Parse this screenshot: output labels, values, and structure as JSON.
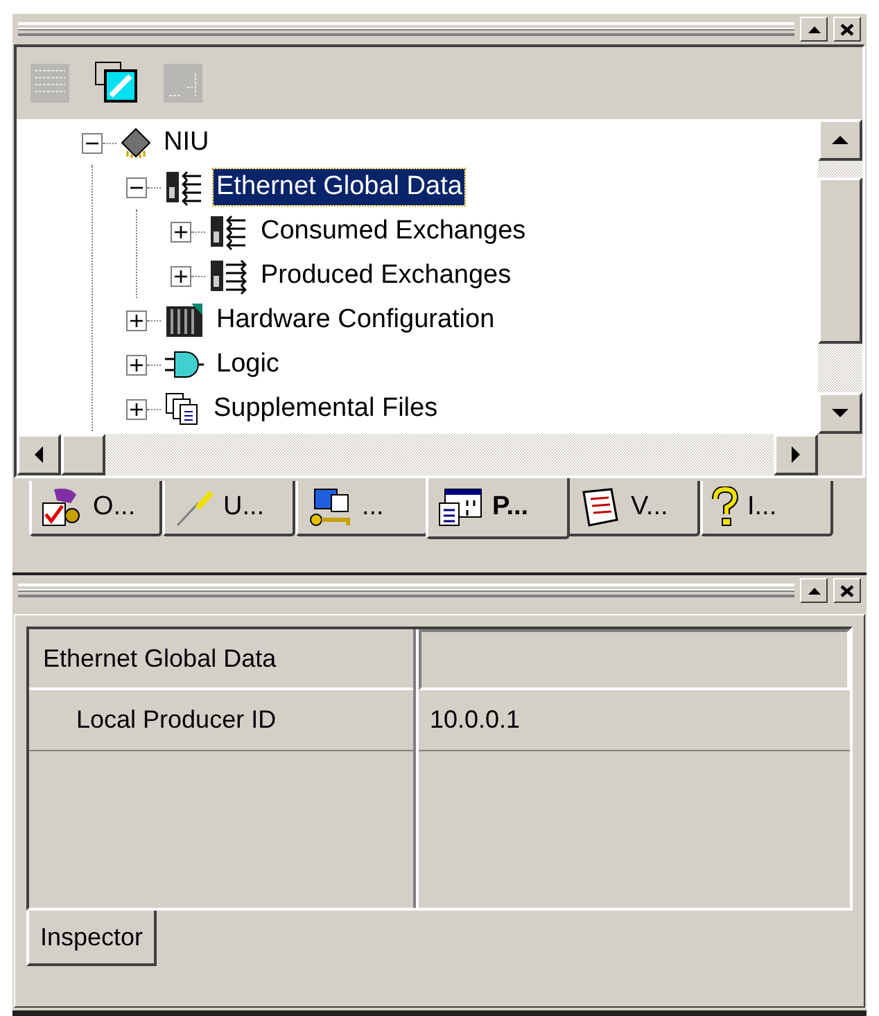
{
  "top_panel": {
    "toolbar": [
      {
        "disabled": true
      },
      {
        "disabled": false
      },
      {
        "disabled": true
      }
    ],
    "tree": [
      {
        "label": "NIU",
        "kind": "chip",
        "expanded": true,
        "selected": false,
        "children": [
          {
            "label": "Ethernet Global Data",
            "kind": "exchange",
            "expanded": true,
            "selected": true,
            "children": [
              {
                "label": "Consumed Exchanges",
                "kind": "consumed",
                "expanded": false,
                "selected": false
              },
              {
                "label": "Produced Exchanges",
                "kind": "produced",
                "expanded": false,
                "selected": false
              }
            ]
          },
          {
            "label": "Hardware Configuration",
            "kind": "rack",
            "expanded": false,
            "selected": false
          },
          {
            "label": "Logic",
            "kind": "gate",
            "expanded": false,
            "selected": false
          },
          {
            "label": "Supplemental Files",
            "kind": "files",
            "expanded": false,
            "selected": false
          }
        ]
      }
    ],
    "tabs": [
      {
        "label": "O...",
        "selected": false
      },
      {
        "label": "U...",
        "selected": false
      },
      {
        "label": "...",
        "selected": false
      },
      {
        "label": "P...",
        "selected": true
      },
      {
        "label": "V...",
        "selected": false
      },
      {
        "label": "I...",
        "selected": false
      }
    ]
  },
  "inspector": {
    "rows": [
      {
        "kind": "category",
        "name": "Ethernet Global Data"
      },
      {
        "kind": "property",
        "name": "Local Producer ID",
        "value": "10.0.0.1"
      }
    ],
    "tabs": [
      {
        "label": "Inspector",
        "selected": true
      }
    ]
  }
}
